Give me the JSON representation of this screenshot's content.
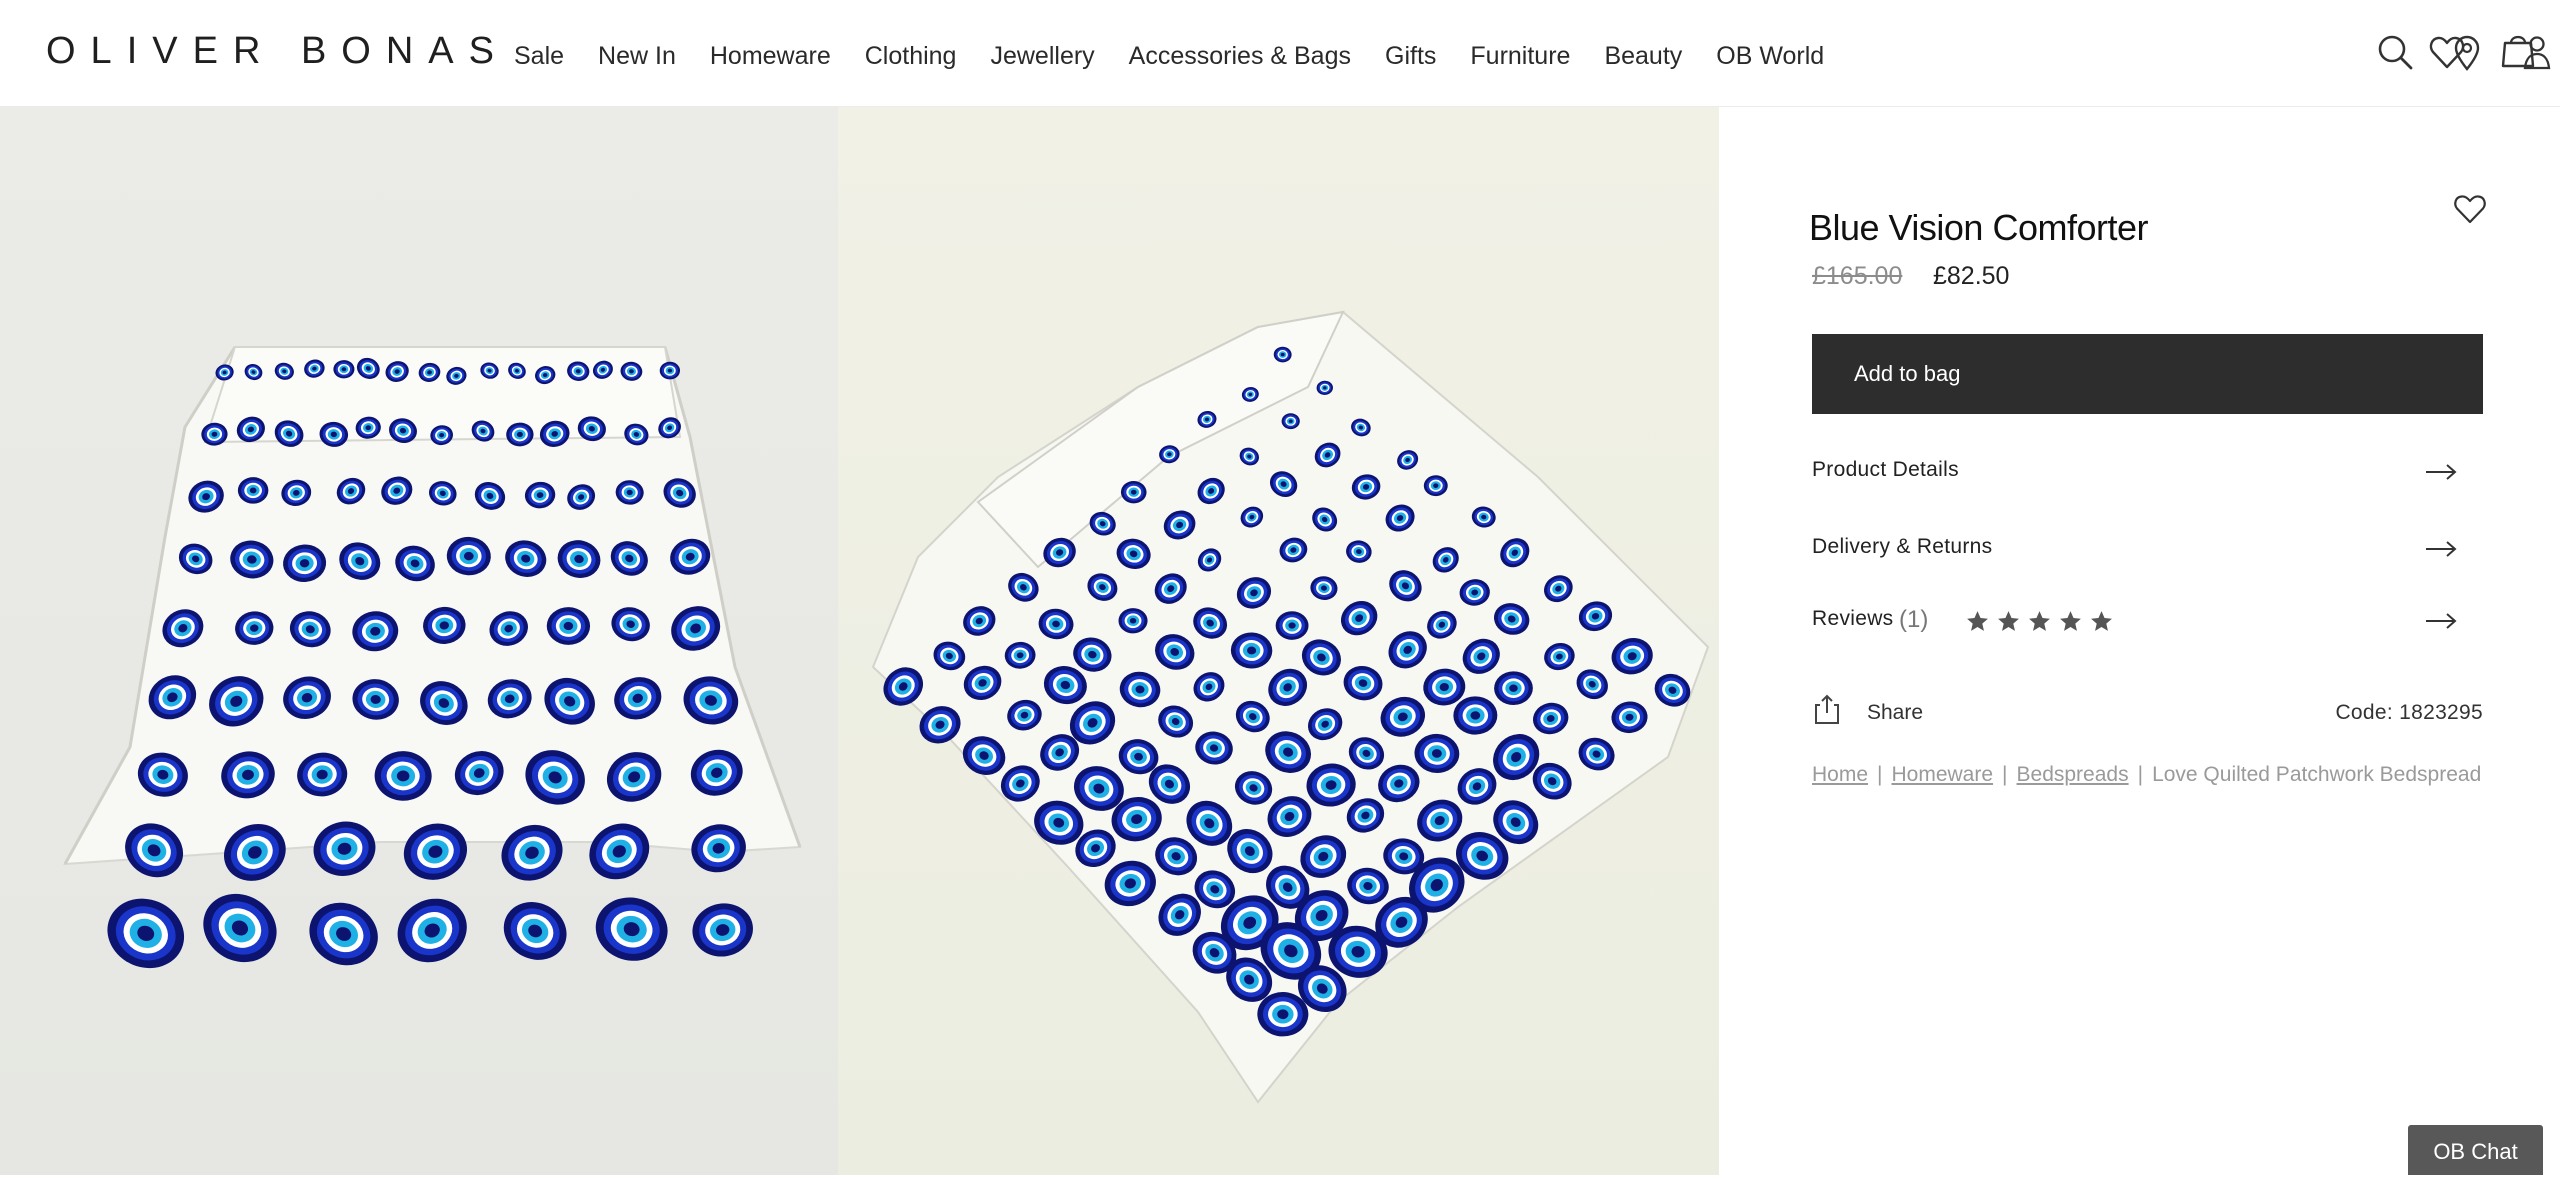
{
  "header": {
    "logo": "OLIVER BONAS",
    "nav": [
      "Sale",
      "New In",
      "Homeware",
      "Clothing",
      "Jewellery",
      "Accessories & Bags",
      "Gifts",
      "Furniture",
      "Beauty",
      "OB World"
    ],
    "icons": [
      "search-icon",
      "store-locator-icon",
      "account-icon",
      "wishlist-icon",
      "bag-icon"
    ]
  },
  "product": {
    "title": "Blue Vision Comforter",
    "price_original": "£165.00",
    "price_sale": "£82.50",
    "add_to_bag": "Add to bag",
    "product_details": "Product Details",
    "delivery_returns": "Delivery & Returns",
    "reviews_label": "Reviews",
    "reviews_count": "(1)",
    "rating": 5,
    "share": "Share",
    "code": "Code: 1823295"
  },
  "breadcrumb": {
    "links": [
      "Home",
      "Homeware",
      "Bedspreads"
    ],
    "current": "Love Quilted Patchwork Bedspread"
  },
  "chat": {
    "label": "OB Chat"
  },
  "colors": {
    "accent": "#2d2d2d",
    "print_blue": "#1a35c9",
    "print_navy": "#0c1470",
    "print_cyan": "#1fb0e6"
  }
}
